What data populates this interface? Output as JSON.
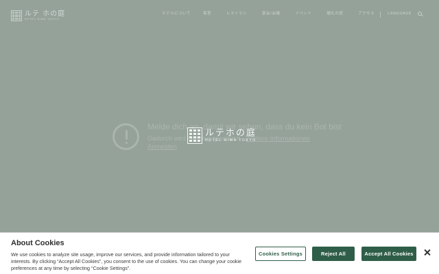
{
  "header": {
    "logo_jp": "ルテ ホの庭",
    "logo_en": "HOTEL NIWA TOKYO",
    "nav": [
      "ホテルについて",
      "客室",
      "レストラン",
      "宴会/会議",
      "イベント",
      "婚礼の庭",
      "アクセス"
    ],
    "language": "LANGUAGE"
  },
  "bot_check": {
    "title": "Melde dich an, damit wir sehen, dass du kein Bot bist",
    "description": "Dadurch wird Gaming geschützt.",
    "more_link": "Weitere Informationen",
    "login_link": "Anmelden"
  },
  "center_logo": {
    "jp": "ルテホの庭",
    "en": "HOTEL NIWA TOKYO"
  },
  "cookie_banner": {
    "title": "About Cookies",
    "text": "We use cookies to analyze site usage, improve our services, and provide information tailored to your interests. By clicking “Accept All Cookies”, you consent to the use of cookies. You can change your cookie preferences at any time by selecting “Cookie Settings”.",
    "settings_label": "Cookies Settings",
    "reject_label": "Reject All",
    "accept_label": "Accept All Cookies"
  },
  "colors": {
    "overlay": "#95a29a",
    "brand_green": "#2f5e48",
    "banner_bg": "#ffffff"
  }
}
